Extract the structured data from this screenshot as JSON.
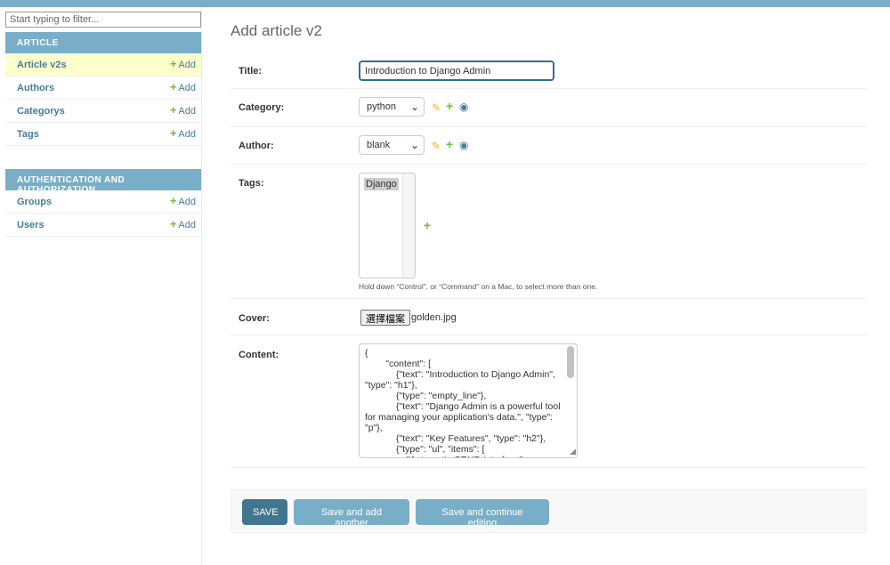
{
  "sidebar": {
    "filter_placeholder": "Start typing to filter...",
    "modules": [
      {
        "title": "Article",
        "items": [
          {
            "label": "Article v2s",
            "add": "Add"
          },
          {
            "label": "Authors",
            "add": "Add"
          },
          {
            "label": "Categorys",
            "add": "Add"
          },
          {
            "label": "Tags",
            "add": "Add"
          }
        ]
      },
      {
        "title": "Authentication and Authorization",
        "items": [
          {
            "label": "Groups",
            "add": "Add"
          },
          {
            "label": "Users",
            "add": "Add"
          }
        ]
      }
    ],
    "active_item": "Article v2s"
  },
  "main": {
    "title": "Add article v2",
    "fields": {
      "title": {
        "label": "Title:",
        "value": "Introduction to Django Admin"
      },
      "category": {
        "label": "Category:",
        "value": "python"
      },
      "author": {
        "label": "Author:",
        "value": "blank"
      },
      "tags": {
        "label": "Tags:",
        "options": [
          "Django"
        ],
        "help": "Hold down “Control”, or “Command” on a Mac, to select more than one."
      },
      "cover": {
        "label": "Cover:",
        "button": "選擇檔案",
        "filename": "golden.jpg"
      },
      "content": {
        "label": "Content:",
        "value": "{\n        \"content\": [\n            {\"text\": \"Introduction to Django Admin\", \"type\": \"h1\"},\n            {\"type\": \"empty_line\"},\n            {\"text\": \"Django Admin is a powerful tool for managing your application's data.\", \"type\": \"p\"},\n            {\"text\": \"Key Features\", \"type\": \"h2\"},\n            {\"type\": \"ul\", \"items\": [\n                \"Automatic CRUD interface\","
      }
    },
    "buttons": {
      "save": "SAVE",
      "save_add_another": "Save and add another",
      "save_continue": "Save and continue editing"
    }
  },
  "colors": {
    "header": "#79aec8",
    "link": "#447e9b",
    "add_icon": "#70bf2b",
    "edit_icon": "#efb80b",
    "save_button": "#417690",
    "active_row": "#ffffcc"
  },
  "icons": {
    "edit": "pencil-icon",
    "add": "plus-icon",
    "view": "eye-icon",
    "dropdown": "chevron-down-icon"
  }
}
